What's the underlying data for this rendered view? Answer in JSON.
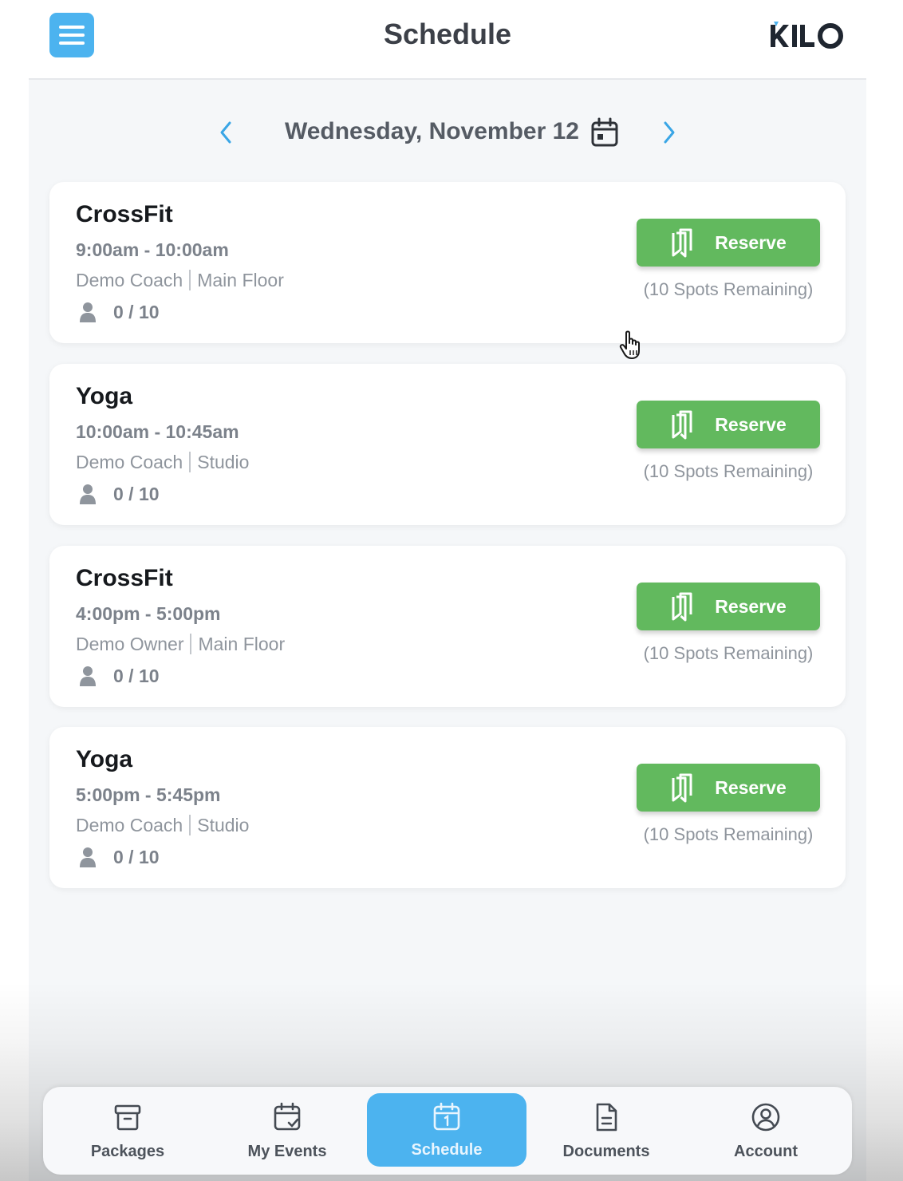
{
  "header": {
    "title": "Schedule",
    "logo_text": "KILO",
    "menu_icon": "hamburger-menu-icon"
  },
  "date_nav": {
    "label": "Wednesday, November 12",
    "prev_icon": "chevron-left-icon",
    "next_icon": "chevron-right-icon",
    "calendar_icon": "calendar-icon"
  },
  "classes": [
    {
      "title": "CrossFit",
      "time": "9:00am - 10:00am",
      "coach": "Demo Coach",
      "location": "Main Floor",
      "capacity": "0 / 10",
      "button": "Reserve",
      "spots": "(10 Spots Remaining)"
    },
    {
      "title": "Yoga",
      "time": "10:00am - 10:45am",
      "coach": "Demo Coach",
      "location": "Studio",
      "capacity": "0 / 10",
      "button": "Reserve",
      "spots": "(10 Spots Remaining)"
    },
    {
      "title": "CrossFit",
      "time": "4:00pm - 5:00pm",
      "coach": "Demo Owner",
      "location": "Main Floor",
      "capacity": "0 / 10",
      "button": "Reserve",
      "spots": "(10 Spots Remaining)"
    },
    {
      "title": "Yoga",
      "time": "5:00pm - 5:45pm",
      "coach": "Demo Coach",
      "location": "Studio",
      "capacity": "0 / 10",
      "button": "Reserve",
      "spots": "(10 Spots Remaining)"
    }
  ],
  "bottom_nav": [
    {
      "label": "Packages",
      "icon": "archive-box-icon",
      "active": false
    },
    {
      "label": "My Events",
      "icon": "calendar-check-icon",
      "active": false
    },
    {
      "label": "Schedule",
      "icon": "calendar-day-icon",
      "active": true
    },
    {
      "label": "Documents",
      "icon": "document-icon",
      "active": false
    },
    {
      "label": "Account",
      "icon": "user-circle-icon",
      "active": false
    }
  ],
  "colors": {
    "accent": "#4cb3ef",
    "reserve_green": "#62b95e",
    "background": "#f5f7f9"
  }
}
